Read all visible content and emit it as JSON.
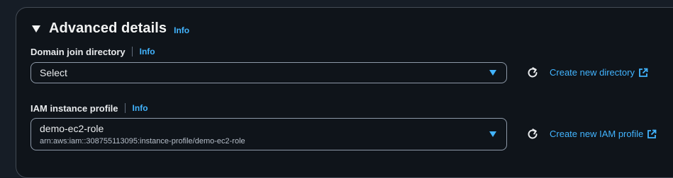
{
  "section": {
    "title": "Advanced details",
    "info_label": "Info"
  },
  "domain_join": {
    "label": "Domain join directory",
    "info_label": "Info",
    "selected_value": "Select",
    "create_link_label": "Create new directory"
  },
  "iam_profile": {
    "label": "IAM instance profile",
    "info_label": "Info",
    "selected_value": "demo-ec2-role",
    "selected_arn": "arn:aws:iam::308755113095:instance-profile/demo-ec2-role",
    "create_link_label": "Create new IAM profile"
  },
  "icons": {
    "caret": "caret-down-icon",
    "select_arrow": "dropdown-arrow-icon",
    "refresh": "refresh-icon",
    "external": "external-link-icon"
  },
  "colors": {
    "background": "#161d26",
    "panel": "#0f141a",
    "link": "#42b4ff",
    "text": "#e9ebed"
  }
}
